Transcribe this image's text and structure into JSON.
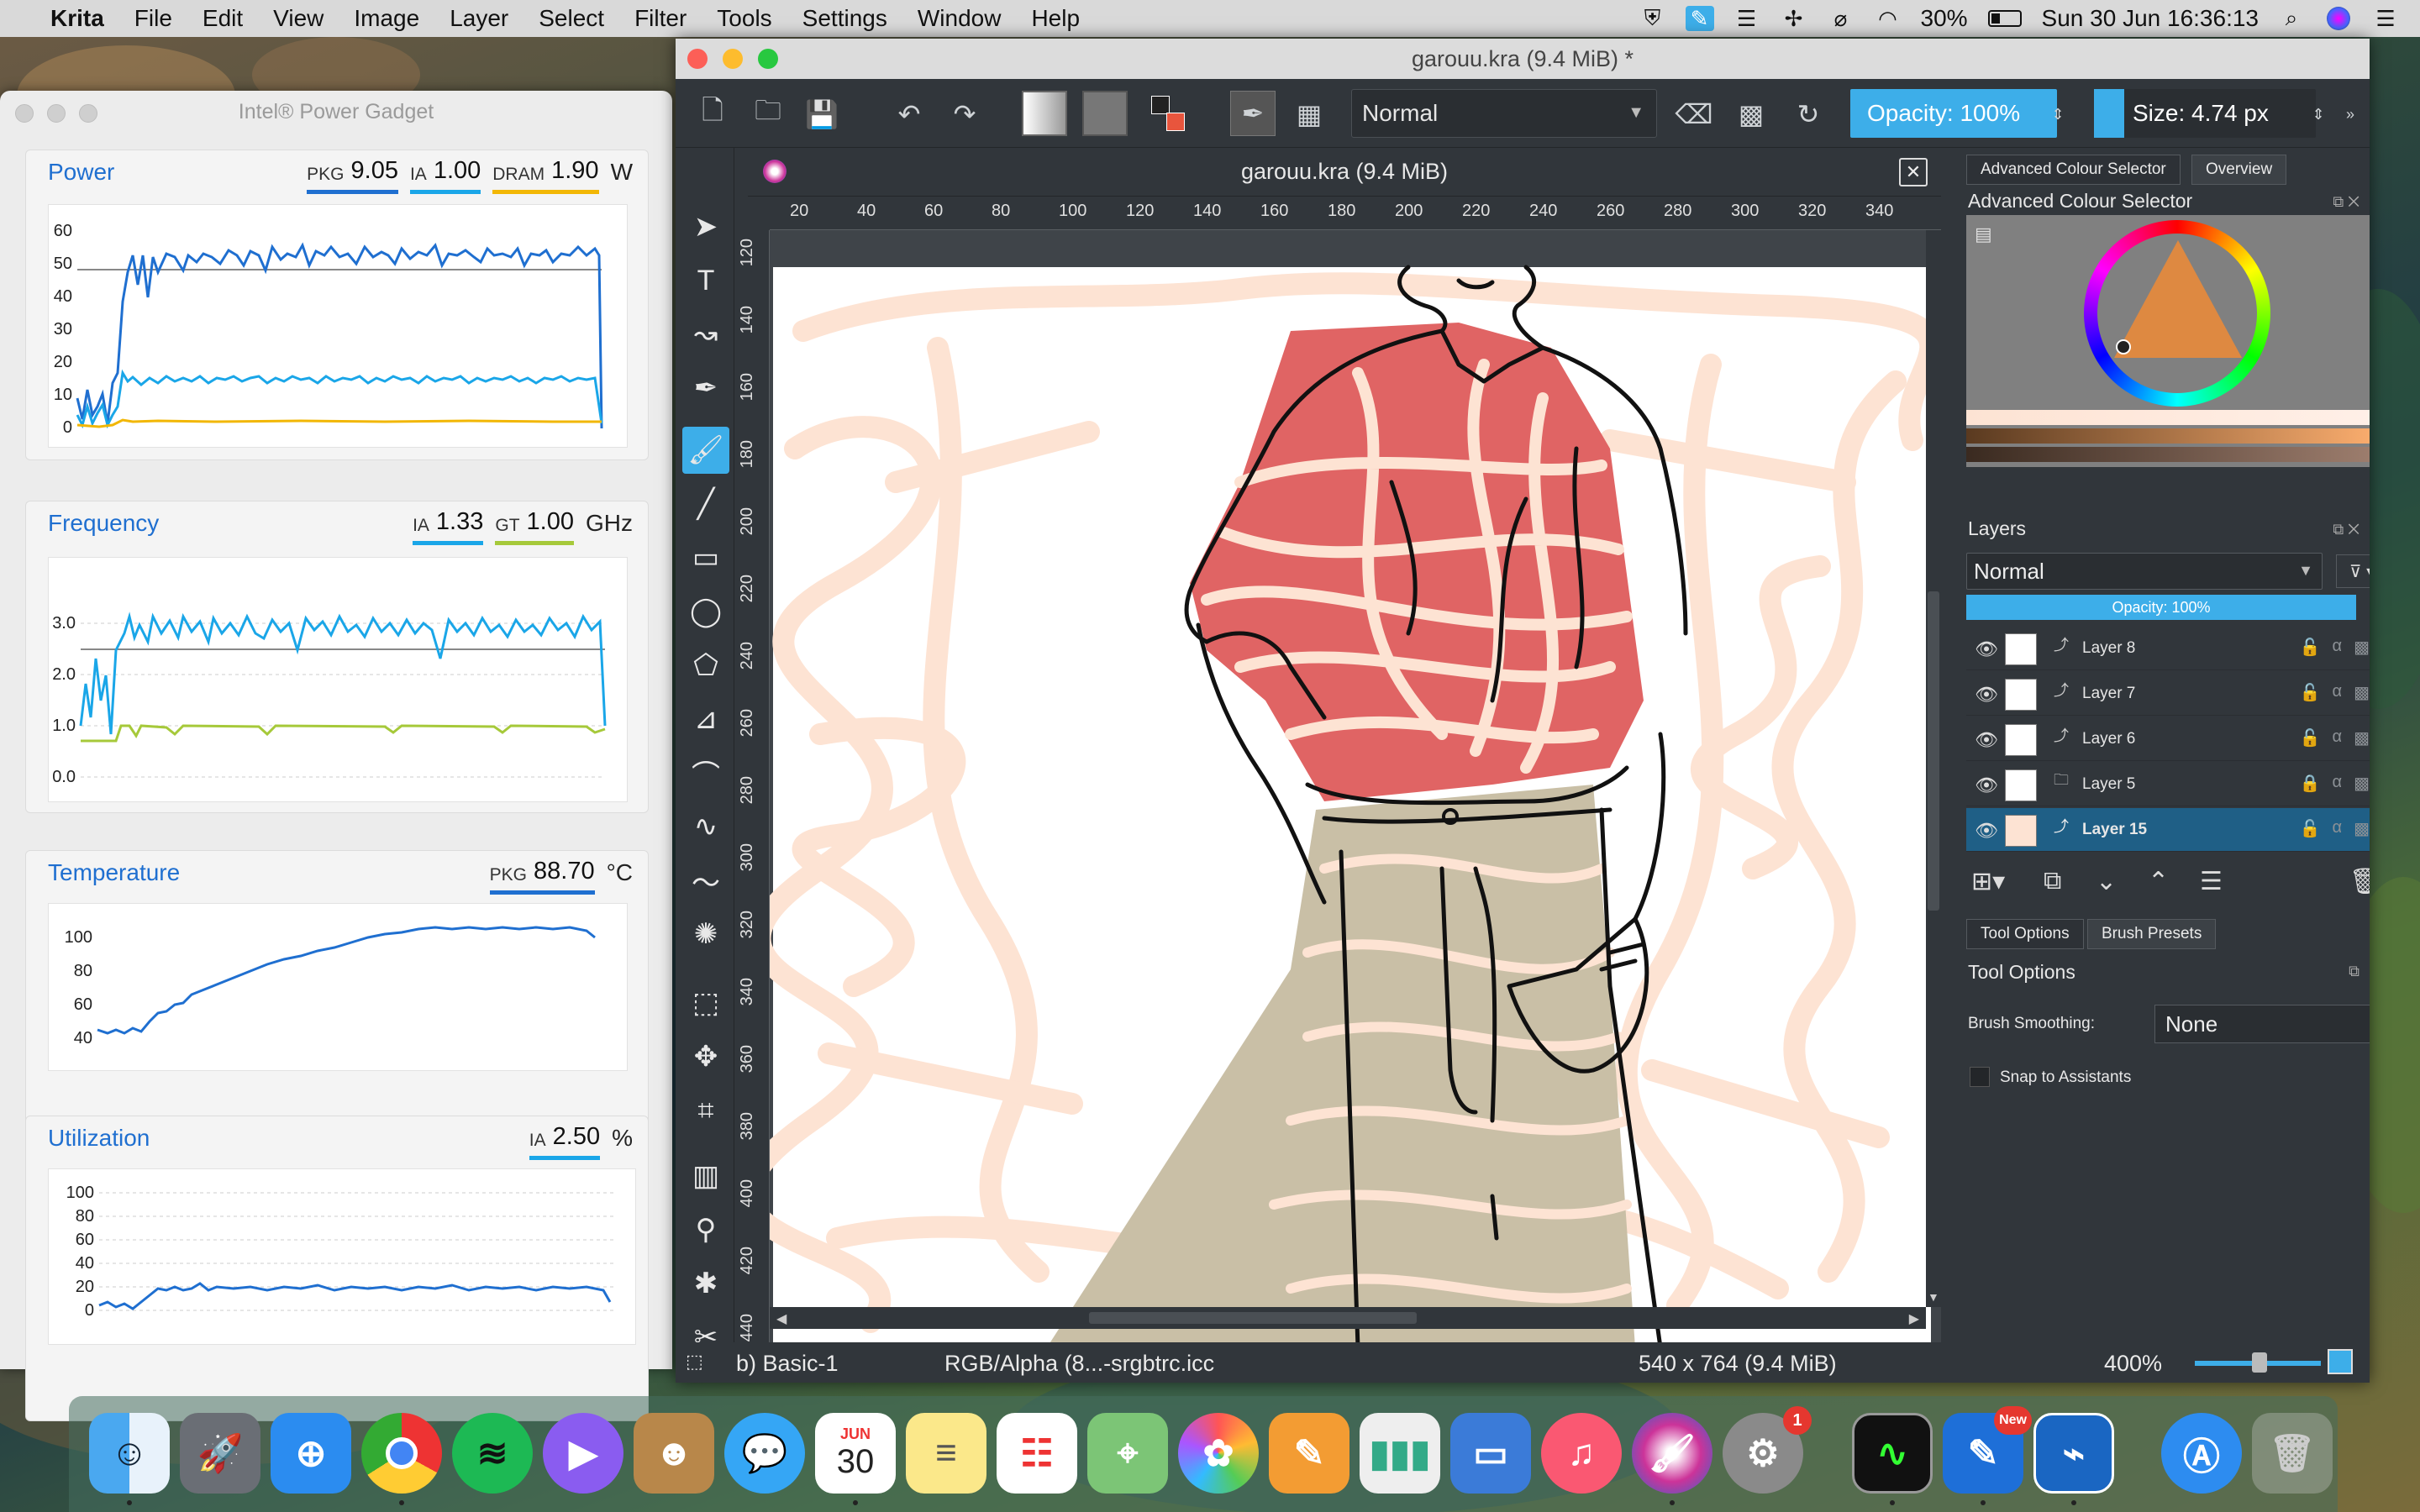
{
  "menubar": {
    "app_name": "Krita",
    "items": [
      "File",
      "Edit",
      "View",
      "Image",
      "Layer",
      "Select",
      "Filter",
      "Tools",
      "Settings",
      "Window",
      "Help"
    ],
    "battery": "30%",
    "datetime": "Sun 30 Jun  16:36:13"
  },
  "power_gadget": {
    "title": "Intel® Power Gadget",
    "power": {
      "heading": "Power",
      "unit": "W",
      "readouts": [
        {
          "key": "PKG",
          "value": "9.05",
          "color": "#1f6fd0"
        },
        {
          "key": "IA",
          "value": "1.00",
          "color": "#1aa6e8"
        },
        {
          "key": "DRAM",
          "value": "1.90",
          "color": "#f2b705"
        }
      ],
      "y_ticks": [
        "60",
        "50",
        "40",
        "30",
        "20",
        "10",
        "0"
      ]
    },
    "frequency": {
      "heading": "Frequency",
      "unit": "GHz",
      "readouts": [
        {
          "key": "IA",
          "value": "1.33",
          "color": "#1aa6e8"
        },
        {
          "key": "GT",
          "value": "1.00",
          "color": "#a6c93a"
        }
      ],
      "y_ticks": [
        "3.0",
        "2.0",
        "1.0",
        "0.0"
      ]
    },
    "temperature": {
      "heading": "Temperature",
      "unit": "°C",
      "readouts": [
        {
          "key": "PKG",
          "value": "88.70",
          "color": "#1f6fd0"
        }
      ],
      "y_ticks": [
        "100",
        "80",
        "60",
        "40"
      ]
    },
    "utilization": {
      "heading": "Utilization",
      "unit": "%",
      "readouts": [
        {
          "key": "IA",
          "value": "2.50",
          "color": "#1aa6e8"
        }
      ],
      "y_ticks": [
        "100",
        "80",
        "60",
        "40",
        "20",
        "0"
      ]
    }
  },
  "krita": {
    "window_title": "garouu.kra (9.4 MiB) *",
    "blend_mode": "Normal",
    "opacity_label": "Opacity:  100%",
    "size_label": "Size:  4.74 px",
    "canvas_tab_title": "garouu.kra (9.4 MiB)",
    "ruler_h": [
      "20",
      "40",
      "60",
      "80",
      "100",
      "120",
      "140",
      "160",
      "180",
      "200",
      "220",
      "240",
      "260",
      "280",
      "300",
      "320",
      "340"
    ],
    "ruler_v": [
      "120",
      "140",
      "160",
      "180",
      "200",
      "220",
      "240",
      "260",
      "280",
      "300",
      "320",
      "340",
      "360",
      "380",
      "400",
      "420",
      "440"
    ],
    "status": {
      "brush": "b) Basic-1",
      "colorspace": "RGB/Alpha (8...-srgbtrc.icc",
      "dimensions": "540 x 764 (9.4 MiB)",
      "zoom": "400%"
    },
    "dockers": {
      "tab_color": "Advanced Colour Selector",
      "tab_overview": "Overview",
      "color_heading": "Advanced Colour Selector",
      "layers_heading": "Layers",
      "layers_blend": "Normal",
      "layers_opacity": "Opacity:  100%",
      "layers": [
        {
          "name": "Layer 8",
          "selected": false
        },
        {
          "name": "Layer 7",
          "selected": false
        },
        {
          "name": "Layer 6",
          "selected": false
        },
        {
          "name": "Layer 5",
          "selected": false
        },
        {
          "name": "Layer 15",
          "selected": true
        }
      ],
      "tab_tool_options": "Tool Options",
      "tab_brush_presets": "Brush Presets",
      "tool_options_heading": "Tool Options",
      "brush_smoothing_label": "Brush Smoothing:",
      "brush_smoothing_value": "None",
      "snap_label": "Snap to Assistants"
    }
  },
  "dock": {
    "calendar_month": "JUN",
    "calendar_day": "30",
    "mail_badge": "1",
    "new_badge": "New"
  },
  "colors": {
    "accent": "#3daee9",
    "krita_bg": "#31363b",
    "shirt": "#e06464",
    "pants": "#c9bfa6",
    "scribble": "#fde6d8"
  }
}
